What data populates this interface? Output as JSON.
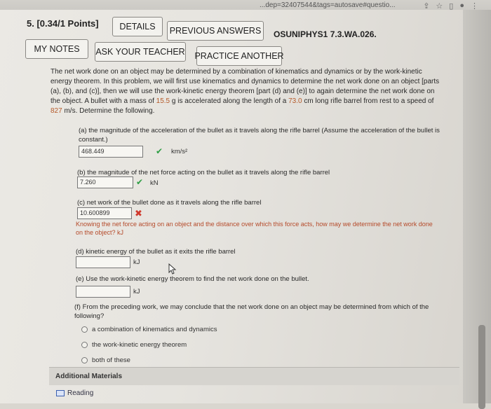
{
  "browser": {
    "url_fragment": "...dep=32407544&tags=autosave#questio...",
    "icons": [
      "share-icon",
      "star-icon",
      "square-icon",
      "profile-icon",
      "menu-icon"
    ]
  },
  "question": {
    "number_label": "5. [0.34/1 Points]",
    "buttons": {
      "details": "DETAILS",
      "previous_answers": "PREVIOUS ANSWERS",
      "my_notes": "MY NOTES",
      "ask_teacher": "ASK YOUR TEACHER",
      "practice_another": "PRACTICE ANOTHER"
    },
    "code": "OSUNIPHYS1 7.3.WA.026.",
    "text_1": "The net work done on an object may be determined by a combination of kinematics and dynamics or by the work-kinetic energy theorem. In this problem, we will first use kinematics and dynamics to determine the net work done on an object [parts (a), (b), and (c)], then we will use the work-kinetic energy theorem [part (d) and (e)] to again determine the net work done on the object. A bullet with a mass of ",
    "mass": "15.5",
    "text_2": " g is accelerated along the length of a ",
    "length": "73.0",
    "text_3": " cm long rifle barrel from rest to a speed of ",
    "speed": "827",
    "text_4": " m/s. Determine the following."
  },
  "parts": {
    "a": {
      "prompt": "(a) the magnitude of the acceleration of the bullet as it travels along the rifle barrel (Assume the acceleration of the bullet is constant.)",
      "value": "468.449",
      "unit": "km/s²",
      "status": "correct"
    },
    "b": {
      "prompt": "(b) the magnitude of the net force acting on the bullet as it travels along the rifle barrel",
      "value": "7.260",
      "unit": "kN",
      "status": "correct"
    },
    "c": {
      "prompt": "(c) net work of the bullet done as it travels along the rifle barrel",
      "value": "10.600899",
      "status": "incorrect",
      "hint": "Knowing the net force acting on an object and the distance over which this force acts, how may we determine the net work done on the object? kJ"
    },
    "d": {
      "prompt": "(d) kinetic energy of the bullet as it exits the rifle barrel",
      "value": "",
      "unit": "kJ"
    },
    "e": {
      "prompt": "(e) Use the work-kinetic energy theorem to find the net work done on the bullet.",
      "value": "",
      "unit": "kJ"
    },
    "f": {
      "prompt": "(f) From the preceding work, we may conclude that the net work done on an object may be determined from which of the following?",
      "options": [
        "a combination of kinematics and dynamics",
        "the work-kinetic energy theorem",
        "both of these"
      ]
    }
  },
  "additional": {
    "title": "Additional Materials",
    "reading": "Reading"
  }
}
